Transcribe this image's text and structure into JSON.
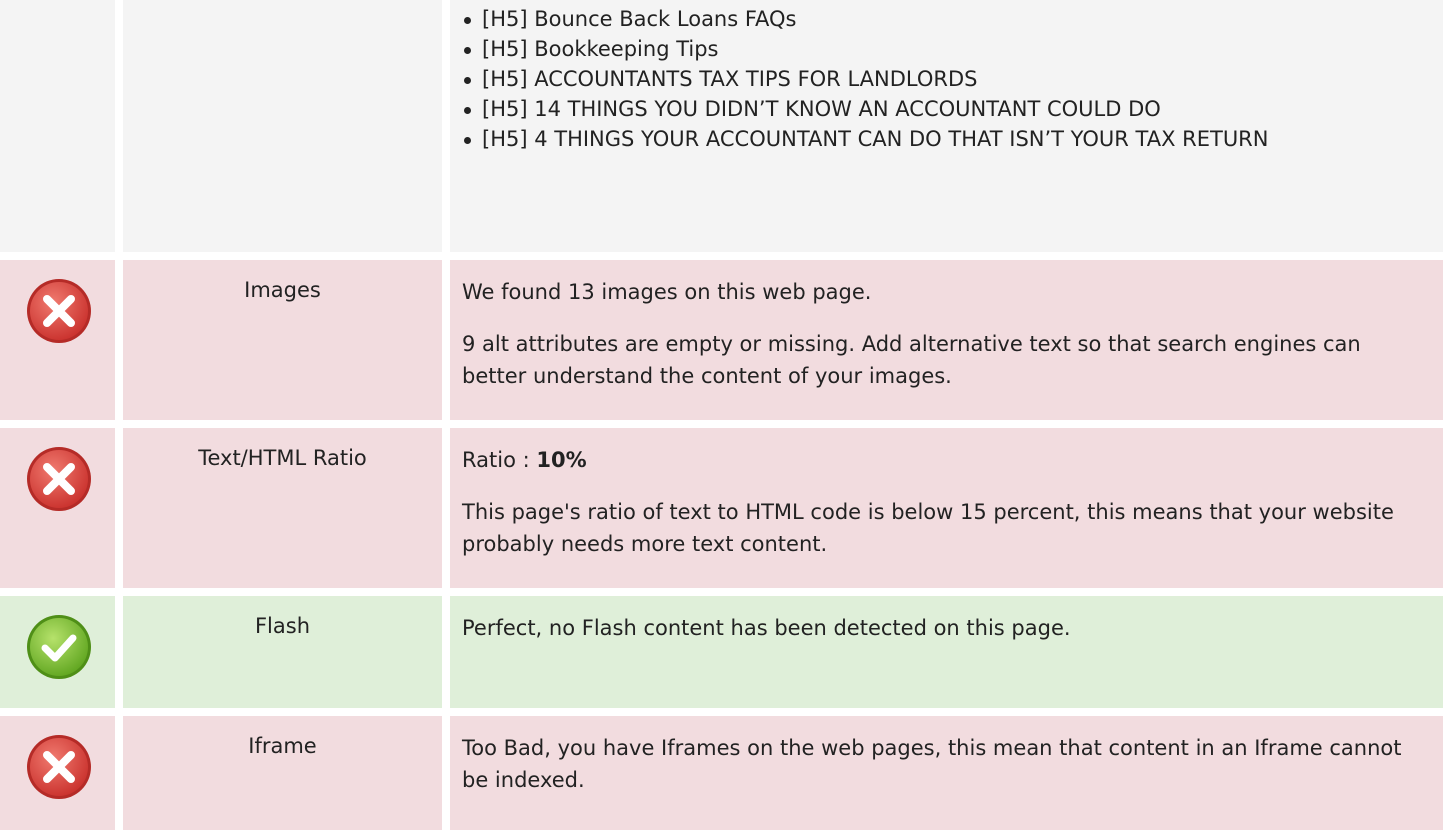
{
  "headings_list": {
    "items": [
      "[H5] Bounce Back Loans FAQs",
      "[H5] Bookkeeping Tips",
      "[H5] ACCOUNTANTS TAX TIPS FOR LANDLORDS",
      "[H5] 14 THINGS YOU DIDN’T KNOW AN ACCOUNTANT COULD DO",
      "[H5] 4 THINGS YOUR ACCOUNTANT CAN DO THAT ISN’T YOUR TAX RETURN"
    ]
  },
  "rows": {
    "images": {
      "status": "error",
      "label": "Images",
      "line1": "We found 13 images on this web page.",
      "line2": "9 alt attributes are empty or missing. Add alternative text so that search engines can better understand the content of your images."
    },
    "ratio": {
      "status": "error",
      "label": "Text/HTML Ratio",
      "ratio_prefix": "Ratio : ",
      "ratio_value": "10%",
      "line2": "This page's ratio of text to HTML code is below 15 percent, this means that your website probably needs more text content."
    },
    "flash": {
      "status": "ok",
      "label": "Flash",
      "line1": "Perfect, no Flash content has been detected on this page."
    },
    "iframe": {
      "status": "error",
      "label": "Iframe",
      "line1": "Too Bad, you have Iframes on the web pages, this mean that content in an Iframe cannot be indexed."
    }
  },
  "icons": {
    "error": "error-x-circle-icon",
    "ok": "check-circle-icon"
  },
  "colors": {
    "error_bg": "#f2dcdf",
    "ok_bg": "#dfefd9",
    "neutral_bg": "#f4f4f4",
    "error_icon": "#d9534f",
    "ok_icon": "#7cbf2f"
  }
}
